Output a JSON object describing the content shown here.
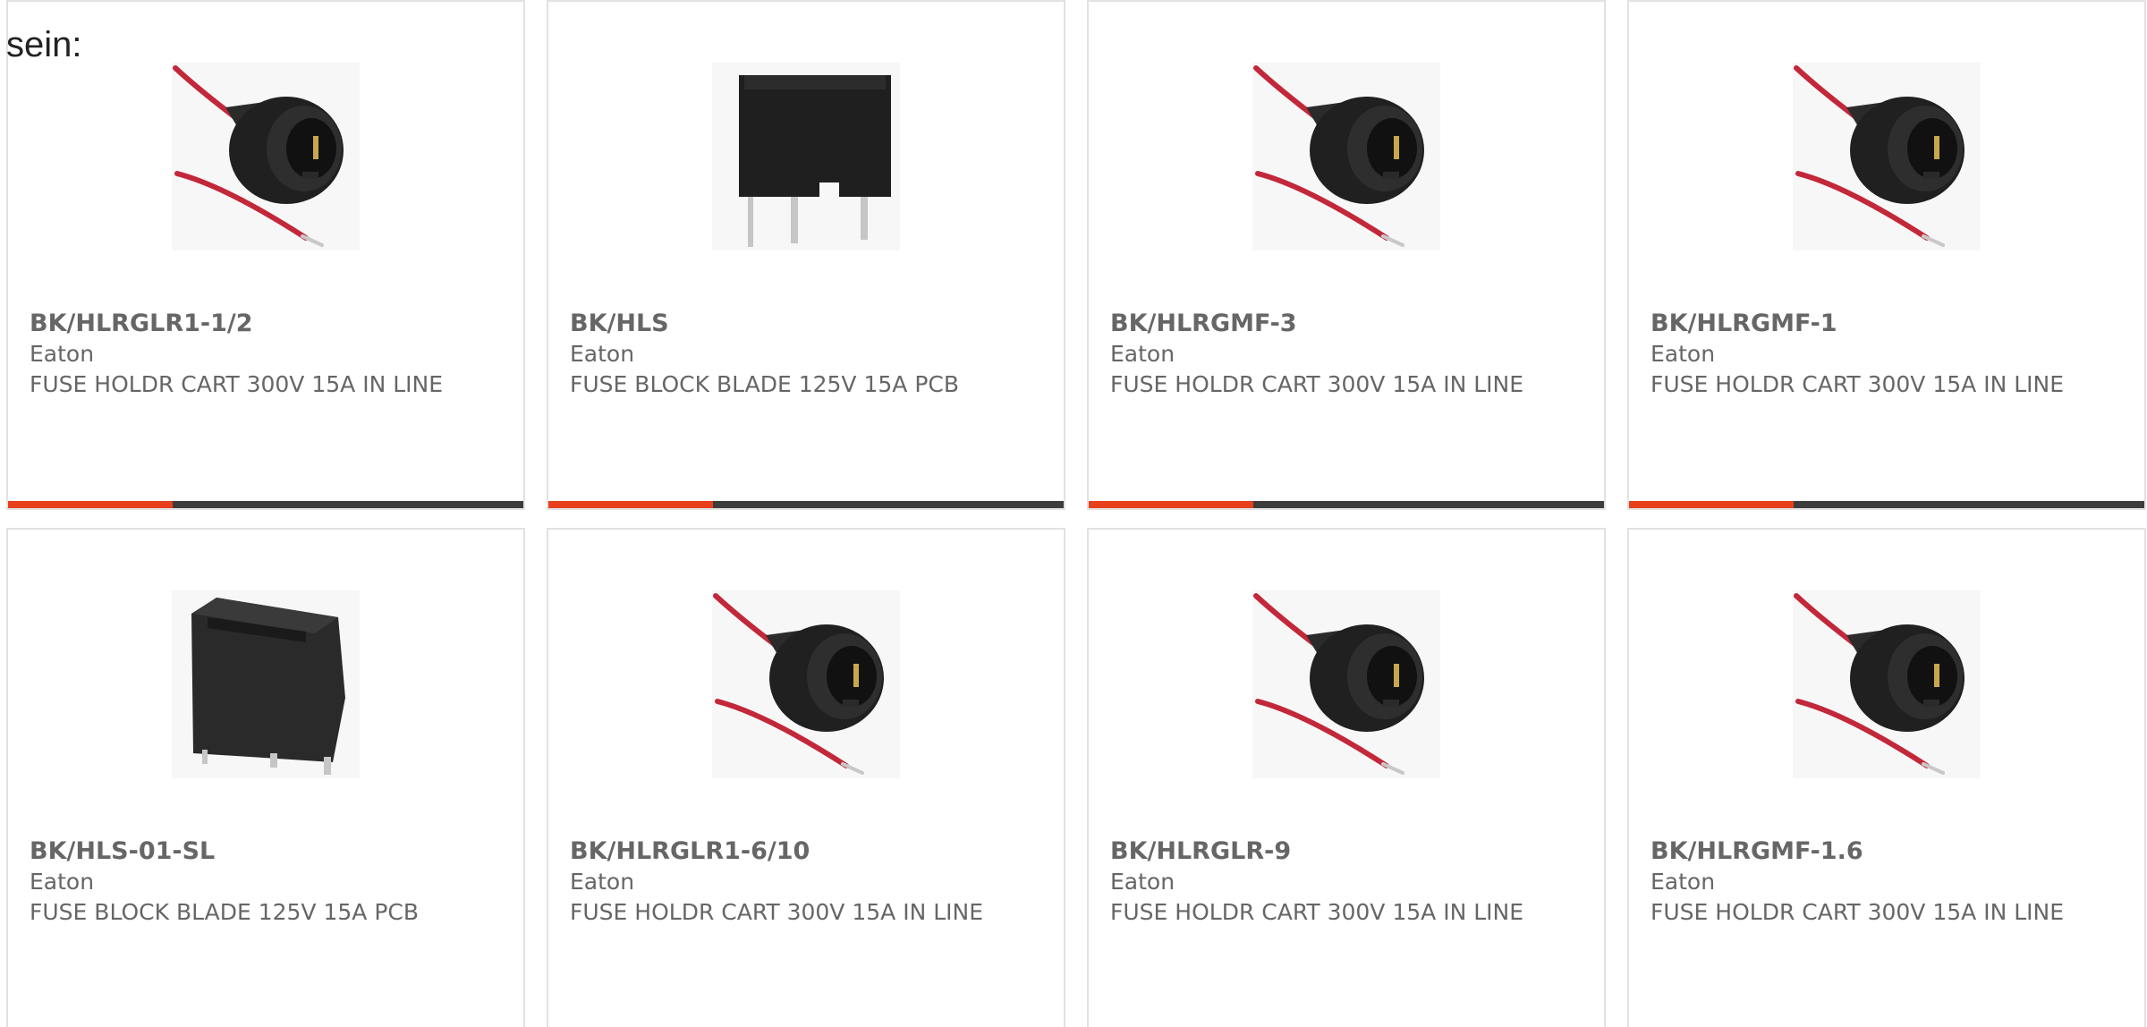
{
  "intro_text": "sein:",
  "colors": {
    "accent": "#e8401c",
    "bar": "#3d3d3d",
    "text": "#666666",
    "border": "#e2e2e2"
  },
  "accent_fill_fraction": 0.32,
  "products": [
    {
      "part_number": "BK/HLRGLR1-1/2",
      "manufacturer": "Eaton",
      "description": "FUSE HOLDR CART 300V 15A IN LINE",
      "image": "inline-fuse-holder-icon"
    },
    {
      "part_number": "BK/HLS",
      "manufacturer": "Eaton",
      "description": "FUSE BLOCK BLADE 125V 15A PCB",
      "image": "blade-fuse-block-icon"
    },
    {
      "part_number": "BK/HLRGMF-3",
      "manufacturer": "Eaton",
      "description": "FUSE HOLDR CART 300V 15A IN LINE",
      "image": "inline-fuse-holder-icon"
    },
    {
      "part_number": "BK/HLRGMF-1",
      "manufacturer": "Eaton",
      "description": "FUSE HOLDR CART 300V 15A IN LINE",
      "image": "inline-fuse-holder-icon"
    },
    {
      "part_number": "BK/HLS-01-SL",
      "manufacturer": "Eaton",
      "description": "FUSE BLOCK BLADE 125V 15A PCB",
      "image": "blade-fuse-block-angled-icon"
    },
    {
      "part_number": "BK/HLRGLR1-6/10",
      "manufacturer": "Eaton",
      "description": "FUSE HOLDR CART 300V 15A IN LINE",
      "image": "inline-fuse-holder-icon"
    },
    {
      "part_number": "BK/HLRGLR-9",
      "manufacturer": "Eaton",
      "description": "FUSE HOLDR CART 300V 15A IN LINE",
      "image": "inline-fuse-holder-icon"
    },
    {
      "part_number": "BK/HLRGMF-1.6",
      "manufacturer": "Eaton",
      "description": "FUSE HOLDR CART 300V 15A IN LINE",
      "image": "inline-fuse-holder-icon"
    }
  ]
}
